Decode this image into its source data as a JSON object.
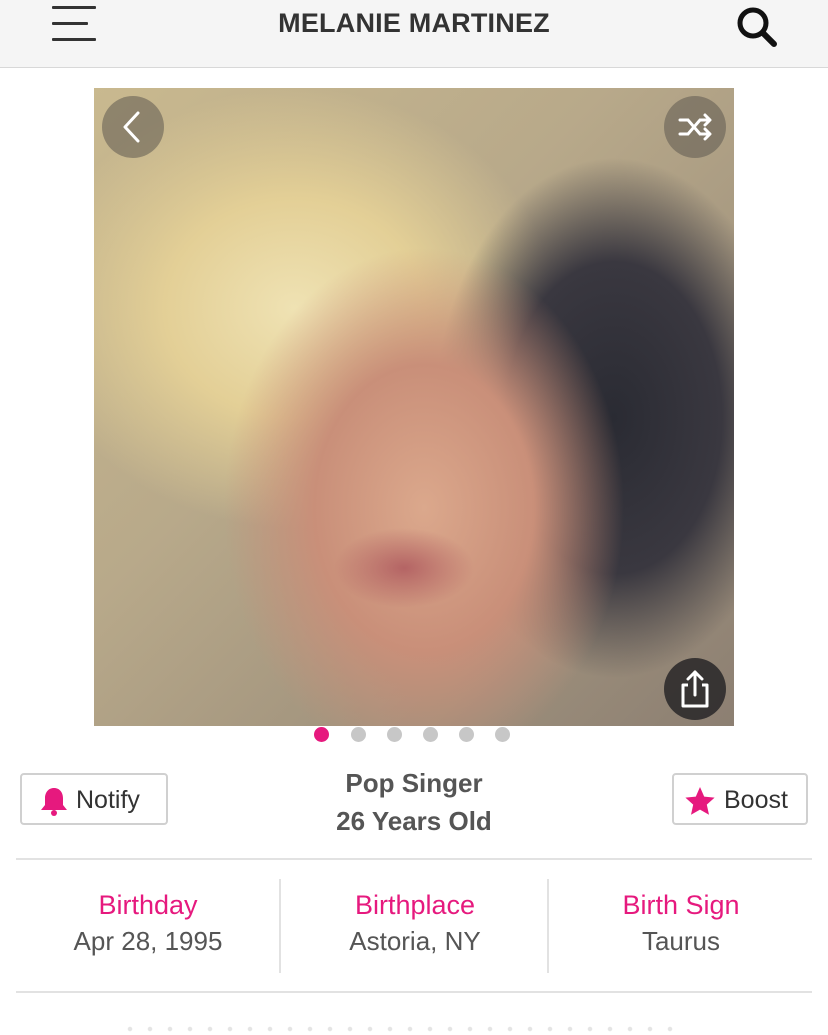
{
  "header": {
    "title": "MELANIE MARTINEZ"
  },
  "photo": {
    "alt": "Portrait photo of Melanie Martinez",
    "total_slides": 6,
    "active_slide": 1
  },
  "actions": {
    "notify_label": "Notify",
    "boost_label": "Boost"
  },
  "profile": {
    "occupation": "Pop Singer",
    "age": "26 Years Old"
  },
  "facts": [
    {
      "label": "Birthday",
      "value": "Apr 28, 1995"
    },
    {
      "label": "Birthplace",
      "value": "Astoria, NY"
    },
    {
      "label": "Birth Sign",
      "value": "Taurus"
    }
  ],
  "colors": {
    "accent": "#e6197e",
    "header_bg": "#f5f5f5",
    "dot_inactive": "#c7c7c7"
  },
  "icons": [
    "menu-icon",
    "search-icon",
    "chevron-left-icon",
    "shuffle-icon",
    "share-icon",
    "bell-icon",
    "star-icon"
  ]
}
